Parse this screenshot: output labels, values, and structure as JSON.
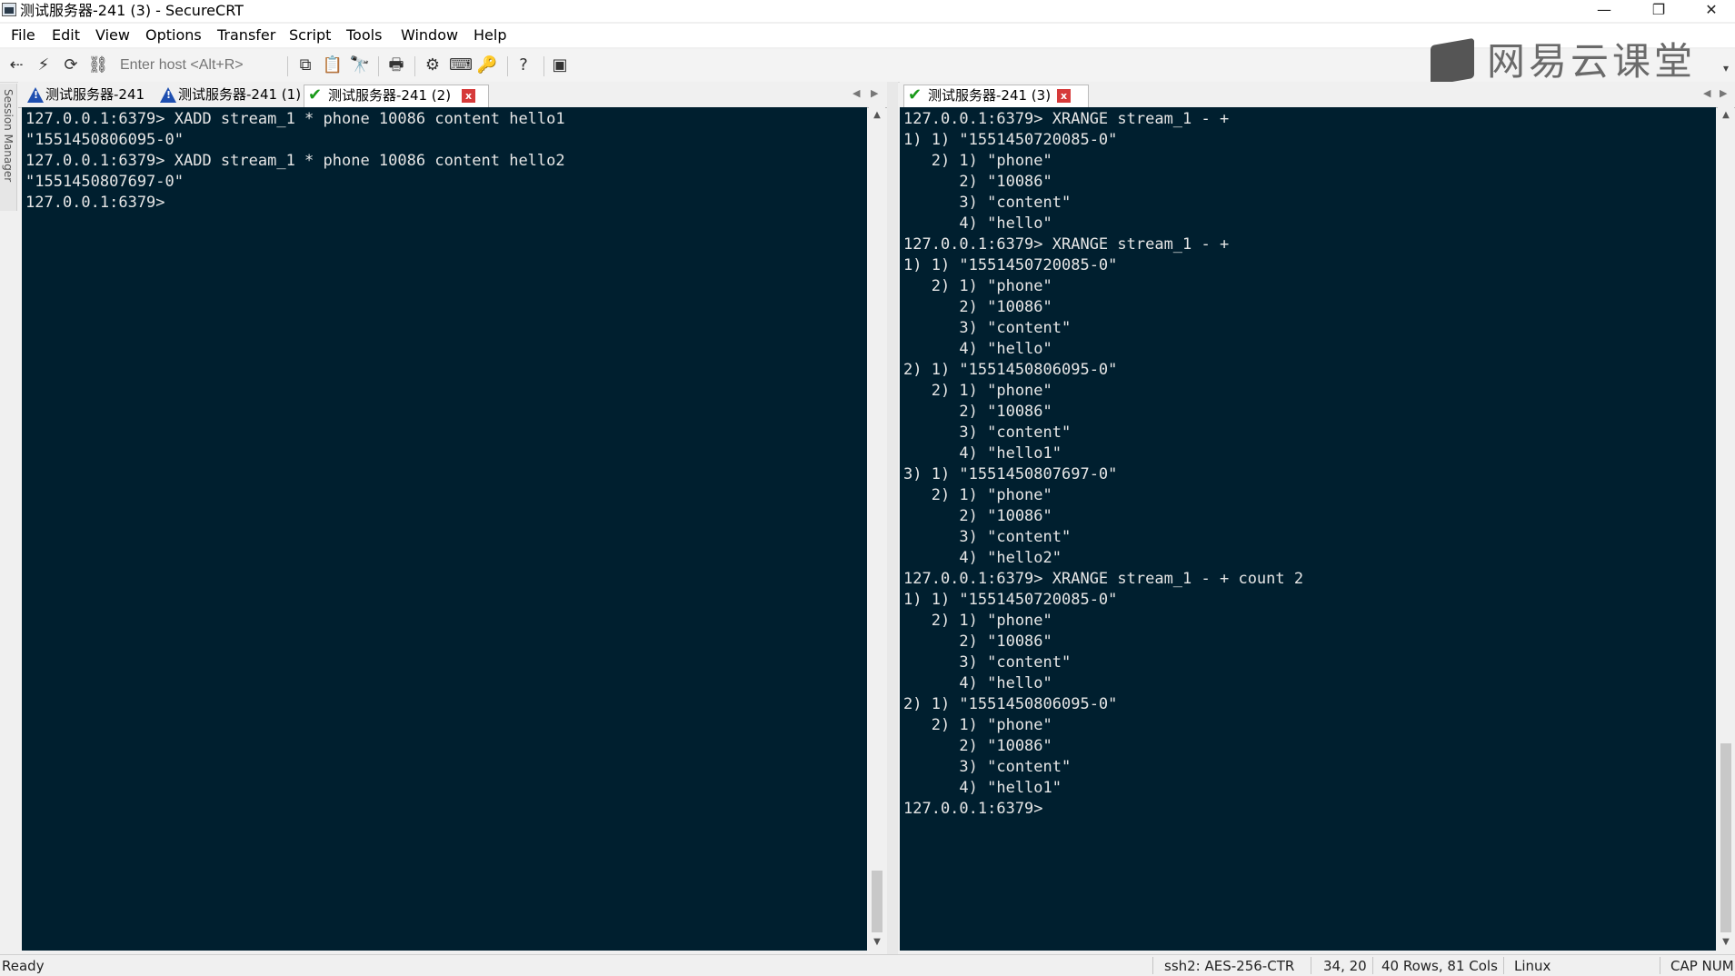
{
  "window": {
    "title": "测试服务器-241 (3) - SecureCRT",
    "minimize": "—",
    "maximize": "❐",
    "close": "✕"
  },
  "menu": [
    "File",
    "Edit",
    "View",
    "Options",
    "Transfer",
    "Script",
    "Tools",
    "Window",
    "Help"
  ],
  "toolbar": {
    "host_placeholder": "Enter host <Alt+R>"
  },
  "brand": {
    "text": "网易云课堂"
  },
  "session_manager": {
    "label": "Session Manager"
  },
  "tabs_left": [
    {
      "label": "测试服务器-241",
      "status": "warning"
    },
    {
      "label": "测试服务器-241 (1)",
      "status": "warning"
    },
    {
      "label": "测试服务器-241 (2)",
      "status": "connected",
      "active": true
    }
  ],
  "tabs_right": [
    {
      "label": "测试服务器-241 (3)",
      "status": "connected",
      "active": true
    }
  ],
  "terminal_left": {
    "lines": [
      "127.0.0.1:6379> XADD stream_1 * phone 10086 content hello1",
      "\"1551450806095-0\"",
      "127.0.0.1:6379> XADD stream_1 * phone 10086 content hello2",
      "\"1551450807697-0\"",
      "127.0.0.1:6379> "
    ]
  },
  "terminal_right": {
    "lines": [
      "127.0.0.1:6379> XRANGE stream_1 - +",
      "1) 1) \"1551450720085-0\"",
      "   2) 1) \"phone\"",
      "      2) \"10086\"",
      "      3) \"content\"",
      "      4) \"hello\"",
      "127.0.0.1:6379> XRANGE stream_1 - +",
      "1) 1) \"1551450720085-0\"",
      "   2) 1) \"phone\"",
      "      2) \"10086\"",
      "      3) \"content\"",
      "      4) \"hello\"",
      "2) 1) \"1551450806095-0\"",
      "   2) 1) \"phone\"",
      "      2) \"10086\"",
      "      3) \"content\"",
      "      4) \"hello1\"",
      "3) 1) \"1551450807697-0\"",
      "   2) 1) \"phone\"",
      "      2) \"10086\"",
      "      3) \"content\"",
      "      4) \"hello2\"",
      "127.0.0.1:6379> XRANGE stream_1 - + count 2",
      "1) 1) \"1551450720085-0\"",
      "   2) 1) \"phone\"",
      "      2) \"10086\"",
      "      3) \"content\"",
      "      4) \"hello\"",
      "2) 1) \"1551450806095-0\"",
      "   2) 1) \"phone\"",
      "      2) \"10086\"",
      "      3) \"content\"",
      "      4) \"hello1\"",
      "127.0.0.1:6379> "
    ]
  },
  "status": {
    "ready": "Ready",
    "protocol": "ssh2: AES-256-CTR",
    "cursor": "34, 20",
    "size": "40 Rows, 81 Cols",
    "os": "Linux",
    "caps": "CAP NUM"
  },
  "colors": {
    "terminal_bg": "#001f2f",
    "terminal_fg": "#e6e6e6",
    "tab_close": "#d63a3a",
    "ok": "#1a9a1a",
    "warn": "#1e4fb0"
  }
}
